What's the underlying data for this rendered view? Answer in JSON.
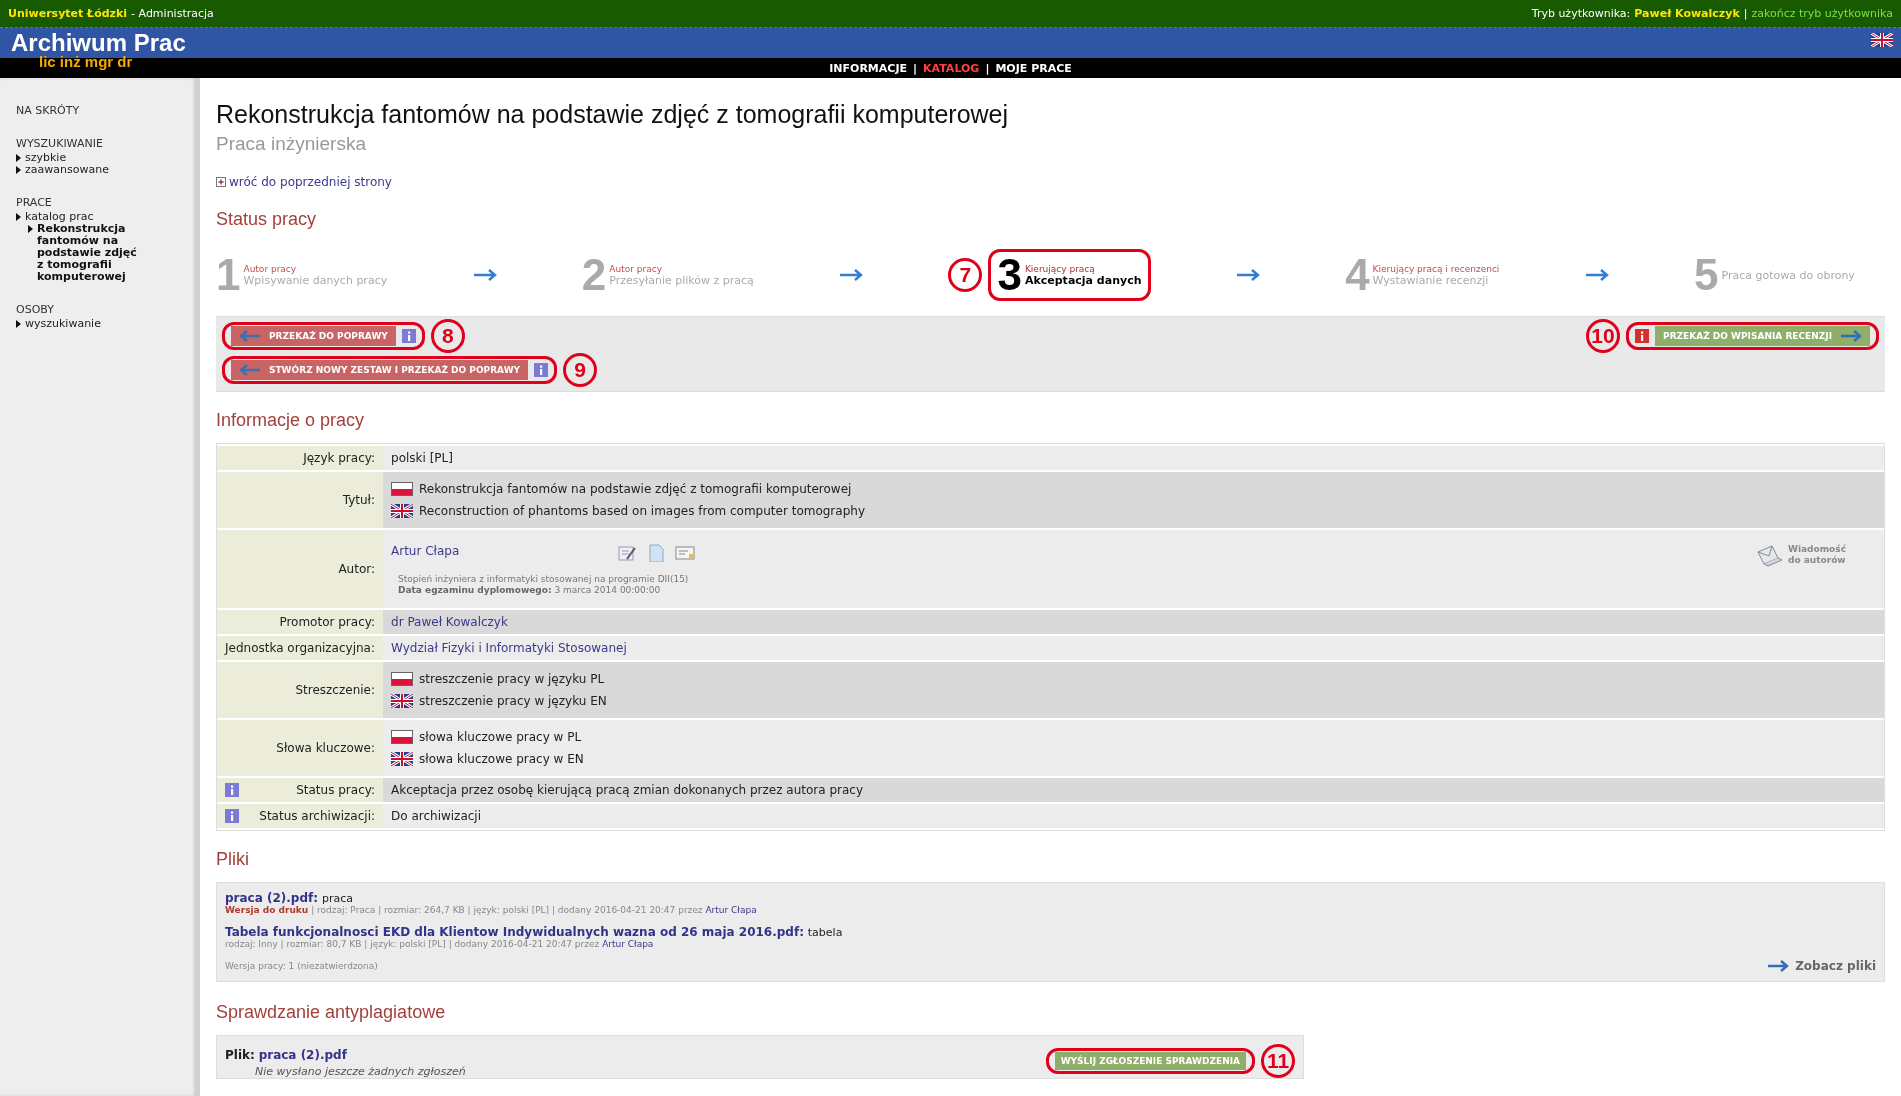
{
  "top_bar": {
    "university": "Uniwersytet Łódzki",
    "section": "- Administracja",
    "user_mode_label": "Tryb użytkownika:",
    "user_name": "Paweł Kowalczyk",
    "separator": "|",
    "end_mode_link": "zakończ tryb użytkownika"
  },
  "header": {
    "logo_title": "Archiwum Prac",
    "logo_subtitle": "lic inż mgr dr",
    "nav_separators": [
      "|",
      "|"
    ],
    "nav": [
      {
        "label": "INFORMACJE",
        "selected": false
      },
      {
        "label": "KATALOG",
        "selected": true
      },
      {
        "label": "MOJE PRACE",
        "selected": false
      }
    ]
  },
  "sidebar": {
    "sections": [
      {
        "title": "NA SKRÓTY"
      },
      {
        "title": "WYSZUKIWANIE",
        "items": [
          {
            "label": "szybkie",
            "selected": false
          },
          {
            "label": "zaawansowane",
            "selected": false
          }
        ]
      },
      {
        "title": "PRACE",
        "items": [
          {
            "label": "katalog prac",
            "selected": false,
            "children": [
              {
                "label": "Rekonstrukcja fantomów na podstawie zdjęć z tomografii komputerowej",
                "selected": true
              }
            ]
          }
        ]
      },
      {
        "title": "OSOBY",
        "items": [
          {
            "label": "wyszukiwanie",
            "selected": false
          }
        ]
      }
    ]
  },
  "main": {
    "title": "Rekonstrukcja fantomów na podstawie zdjęć z tomografii komputerowej",
    "subtitle": "Praca inżynierska",
    "back_link": "wróć do poprzedniej strony",
    "status": {
      "heading": "Status pracy",
      "steps": [
        {
          "number": "1",
          "role": "Autor pracy",
          "label": "Wpisywanie danych pracy",
          "current": false
        },
        {
          "number": "2",
          "role": "Autor pracy",
          "label": "Przesyłanie plików z pracą",
          "current": false
        },
        {
          "number": "3",
          "role": "Kierujący pracą",
          "label": "Akceptacja danych",
          "current": true,
          "annotation": "7"
        },
        {
          "number": "4",
          "role": "Kierujący pracą i recenzenci",
          "label": "Wystawianie recenzji",
          "current": false
        },
        {
          "number": "5",
          "label": "Praca gotowa do obrony",
          "current": false
        }
      ],
      "actions": [
        {
          "label": "PRZEKAŻ DO POPRAWY",
          "kind": "back",
          "annotation": "8"
        },
        {
          "label": "STWÓRZ NOWY ZESTAW I PRZEKAŻ DO POPRAWY",
          "kind": "back",
          "annotation": "9"
        },
        {
          "label": "PRZEKAŻ DO WPISANIA RECENZJI",
          "kind": "forward",
          "annotation": "10"
        }
      ]
    },
    "info": {
      "heading": "Informacje o pracy",
      "rows": [
        {
          "kind": "text",
          "label": "Język pracy:",
          "value": "polski [PL]"
        },
        {
          "kind": "flags",
          "label": "Tytuł:",
          "lines": [
            {
              "kind": "pl",
              "text": "Rekonstrukcja fantomów na podstawie zdjęć z tomografii komputerowej"
            },
            {
              "kind": "en",
              "text": "Reconstruction of phantoms based on images from computer tomography"
            }
          ]
        },
        {
          "kind": "author",
          "label": "Autor:",
          "name": "Artur Cłapa",
          "degree": "Stopień inżyniera z informatyki stosowanej na programie DII(15)",
          "exam_label": "Data egzaminu dyplomowego:",
          "exam_date": "3 marca 2014 00:00:00",
          "message": "Wiadomość do autorów"
        },
        {
          "kind": "link",
          "label": "Promotor pracy:",
          "value": "dr Paweł Kowalczyk"
        },
        {
          "kind": "link",
          "label": "Jednostka organizacyjna:",
          "value": "Wydział Fizyki i Informatyki Stosowanej"
        },
        {
          "kind": "flags",
          "label": "Streszczenie:",
          "lines": [
            {
              "kind": "pl",
              "text": "streszczenie pracy w języku PL"
            },
            {
              "kind": "en",
              "text": "streszczenie pracy w języku EN"
            }
          ]
        },
        {
          "kind": "flags",
          "label": "Słowa kluczowe:",
          "lines": [
            {
              "kind": "pl",
              "text": "słowa kluczowe pracy w PL"
            },
            {
              "kind": "en",
              "text": "słowa kluczowe pracy w EN"
            }
          ]
        },
        {
          "kind": "text",
          "label": "Status pracy:",
          "value": "Akceptacja przez osobę kierującą pracą zmian dokonanych przez autora pracy",
          "info": true
        },
        {
          "kind": "text",
          "label": "Status archiwizacji:",
          "value": "Do archiwizacji",
          "info": true
        }
      ]
    },
    "files": {
      "heading": "Pliki",
      "items": [
        {
          "name": "praca (2).pdf:",
          "description": "praca",
          "tag": "Wersja do druku",
          "meta": "| rodzaj: Praca | rozmiar: 264,7 KB | język: polski [PL] | dodany 2016-04-21 20:47 przez",
          "author": "Artur Cłapa"
        },
        {
          "name": "Tabela funkcjonalnosci EKD dla Klientow Indywidualnych wazna od 26 maja 2016.pdf:",
          "description": "tabela",
          "meta": "rodzaj: Inny | rozmiar: 80,7 KB | język: polski [PL] | dodany 2016-04-21 20:47 przez",
          "author": "Artur Cłapa"
        }
      ],
      "version_note": "Wersja pracy: 1 (niezatwierdzona)",
      "see_files": "Zobacz pliki"
    },
    "plagiarism": {
      "heading": "Sprawdzanie antyplagiatowe",
      "file_label": "Plik:",
      "file_name": "praca (2).pdf",
      "note": "Nie wysłano jeszcze żadnych zgłoszeń",
      "button": "WYŚLIJ ZGŁOSZENIE SPRAWDZENIA",
      "annotation": "11"
    }
  }
}
